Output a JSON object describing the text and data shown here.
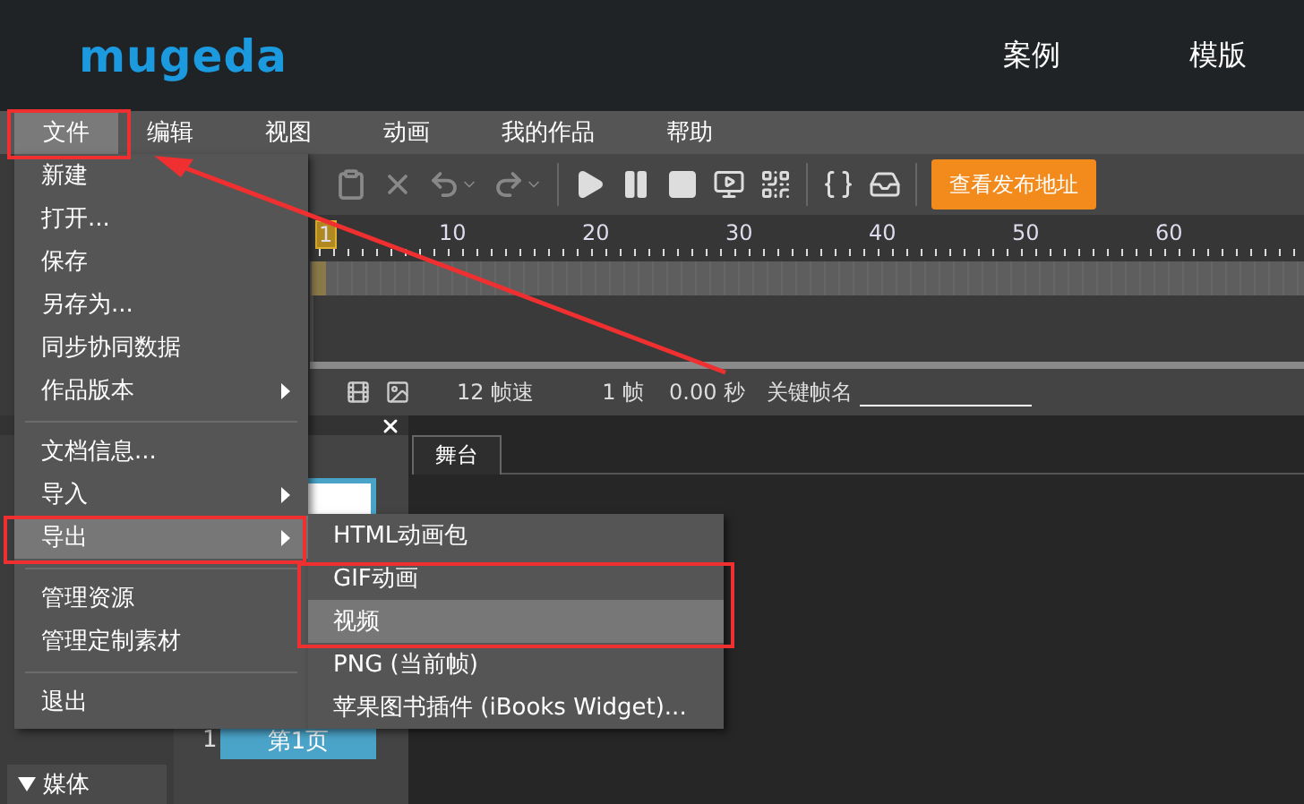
{
  "header": {
    "logo": "mugeda",
    "nav": [
      "案例",
      "模版"
    ]
  },
  "menubar": [
    {
      "label": "文件",
      "selected": true
    },
    {
      "label": "编辑",
      "selected": false
    },
    {
      "label": "视图",
      "selected": false
    },
    {
      "label": "动画",
      "selected": false
    },
    {
      "label": "我的作品",
      "selected": false
    },
    {
      "label": "帮助",
      "selected": false
    }
  ],
  "file_menu": [
    {
      "kind": "item",
      "label": "新建",
      "has_submenu": false,
      "selected": false
    },
    {
      "kind": "item",
      "label": "打开...",
      "has_submenu": false,
      "selected": false
    },
    {
      "kind": "item",
      "label": "保存",
      "has_submenu": false,
      "selected": false
    },
    {
      "kind": "item",
      "label": "另存为...",
      "has_submenu": false,
      "selected": false
    },
    {
      "kind": "item",
      "label": "同步协同数据",
      "has_submenu": false,
      "selected": false
    },
    {
      "kind": "item",
      "label": "作品版本",
      "has_submenu": true,
      "selected": false
    },
    {
      "kind": "separator"
    },
    {
      "kind": "item",
      "label": "文档信息...",
      "has_submenu": false,
      "selected": false
    },
    {
      "kind": "item",
      "label": "导入",
      "has_submenu": true,
      "selected": false
    },
    {
      "kind": "item",
      "label": "导出",
      "has_submenu": true,
      "selected": true
    },
    {
      "kind": "separator"
    },
    {
      "kind": "item",
      "label": "管理资源",
      "has_submenu": false,
      "selected": false
    },
    {
      "kind": "item",
      "label": "管理定制素材",
      "has_submenu": false,
      "selected": false
    },
    {
      "kind": "separator"
    },
    {
      "kind": "item",
      "label": "退出",
      "has_submenu": false,
      "selected": false
    }
  ],
  "export_submenu": [
    {
      "label": "HTML动画包",
      "selected": false
    },
    {
      "label": "GIF动画",
      "selected": false
    },
    {
      "label": "视频",
      "selected": true
    },
    {
      "label": "PNG (当前帧)",
      "selected": false
    },
    {
      "label": "苹果图书插件 (iBooks Widget)...",
      "selected": false
    }
  ],
  "toolbar": {
    "publish_button": "查看发布地址"
  },
  "timeline": {
    "ruler": [
      {
        "label": "1",
        "selected": true
      },
      {
        "label": "10",
        "selected": false
      },
      {
        "label": "20",
        "selected": false
      },
      {
        "label": "30",
        "selected": false
      },
      {
        "label": "40",
        "selected": false
      },
      {
        "label": "50",
        "selected": false
      },
      {
        "label": "60",
        "selected": false
      }
    ]
  },
  "status": {
    "fps": "12 帧速",
    "frame": "1 帧",
    "time": "0.00 秒",
    "keyframe_label": "关键帧名"
  },
  "library": {
    "section": "媒体",
    "expanded": true
  },
  "pages": [
    {
      "number": "1",
      "label": "第1页",
      "selected": true
    }
  ],
  "stage_tab": {
    "label": "舞台",
    "selected": true
  }
}
